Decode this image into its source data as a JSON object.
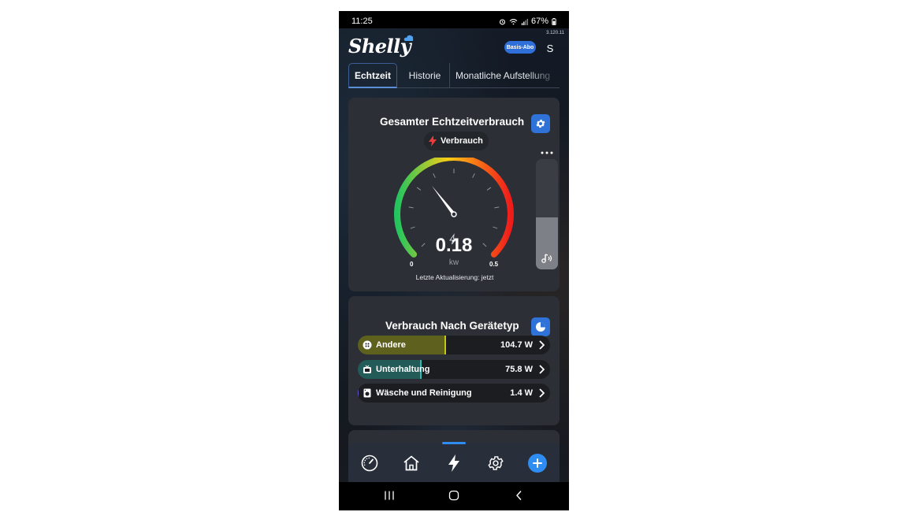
{
  "status_bar": {
    "time": "11:25",
    "battery": "67%"
  },
  "header": {
    "logo_text": "Shelly",
    "version": "3.120.11",
    "plan_badge": "Basis-Abo",
    "avatar_letter": "S"
  },
  "tabs": [
    {
      "label": "Echtzeit",
      "active": true
    },
    {
      "label": "Historie",
      "active": false
    },
    {
      "label": "Monatliche Aufstellung",
      "active": false
    }
  ],
  "realtime_card": {
    "title": "Gesamter Echtzeitverbrauch",
    "settings_icon": "gear-icon",
    "pill_label": "Verbrauch",
    "pill_icon": "bolt-icon",
    "gauge": {
      "value": 0.18,
      "value_text": "0.18",
      "unit": "kw",
      "min": "0",
      "max": "0.5",
      "min_value": 0,
      "max_value": 0.5
    },
    "last_update": "Letzte Aktualisierung: jetzt",
    "volume_level": 0.47,
    "gradient_colors": [
      "#22c55e",
      "#facc15",
      "#f97316",
      "#ef1c1c"
    ]
  },
  "device_card": {
    "title": "Verbrauch Nach Gerätetyp",
    "icon": "pie-chart-icon",
    "rows": [
      {
        "label": "Andere",
        "value": "104.7 W",
        "watts": 104.7,
        "fraction": 0.46,
        "color": "#c3c51a",
        "icon": "dots-icon"
      },
      {
        "label": "Unterhaltung",
        "value": "75.8 W",
        "watts": 75.8,
        "fraction": 0.33,
        "color": "#2fb8b0",
        "icon": "tv-icon"
      },
      {
        "label": "Wäsche und Reinigung",
        "value": "1.4 W",
        "watts": 1.4,
        "fraction": 0.006,
        "color": "#6a55d6",
        "icon": "washer-icon"
      }
    ]
  },
  "bottom_nav": [
    {
      "name": "gauge",
      "icon": "speedometer-icon"
    },
    {
      "name": "home",
      "icon": "home-icon"
    },
    {
      "name": "energy",
      "icon": "bolt-icon",
      "active": true
    },
    {
      "name": "settings",
      "icon": "gear-icon"
    },
    {
      "name": "add",
      "icon": "plus-icon"
    }
  ],
  "colors": {
    "accent": "#2f72d8",
    "card_bg": "#2c2f35",
    "nav_active": "#2f8cf0"
  }
}
